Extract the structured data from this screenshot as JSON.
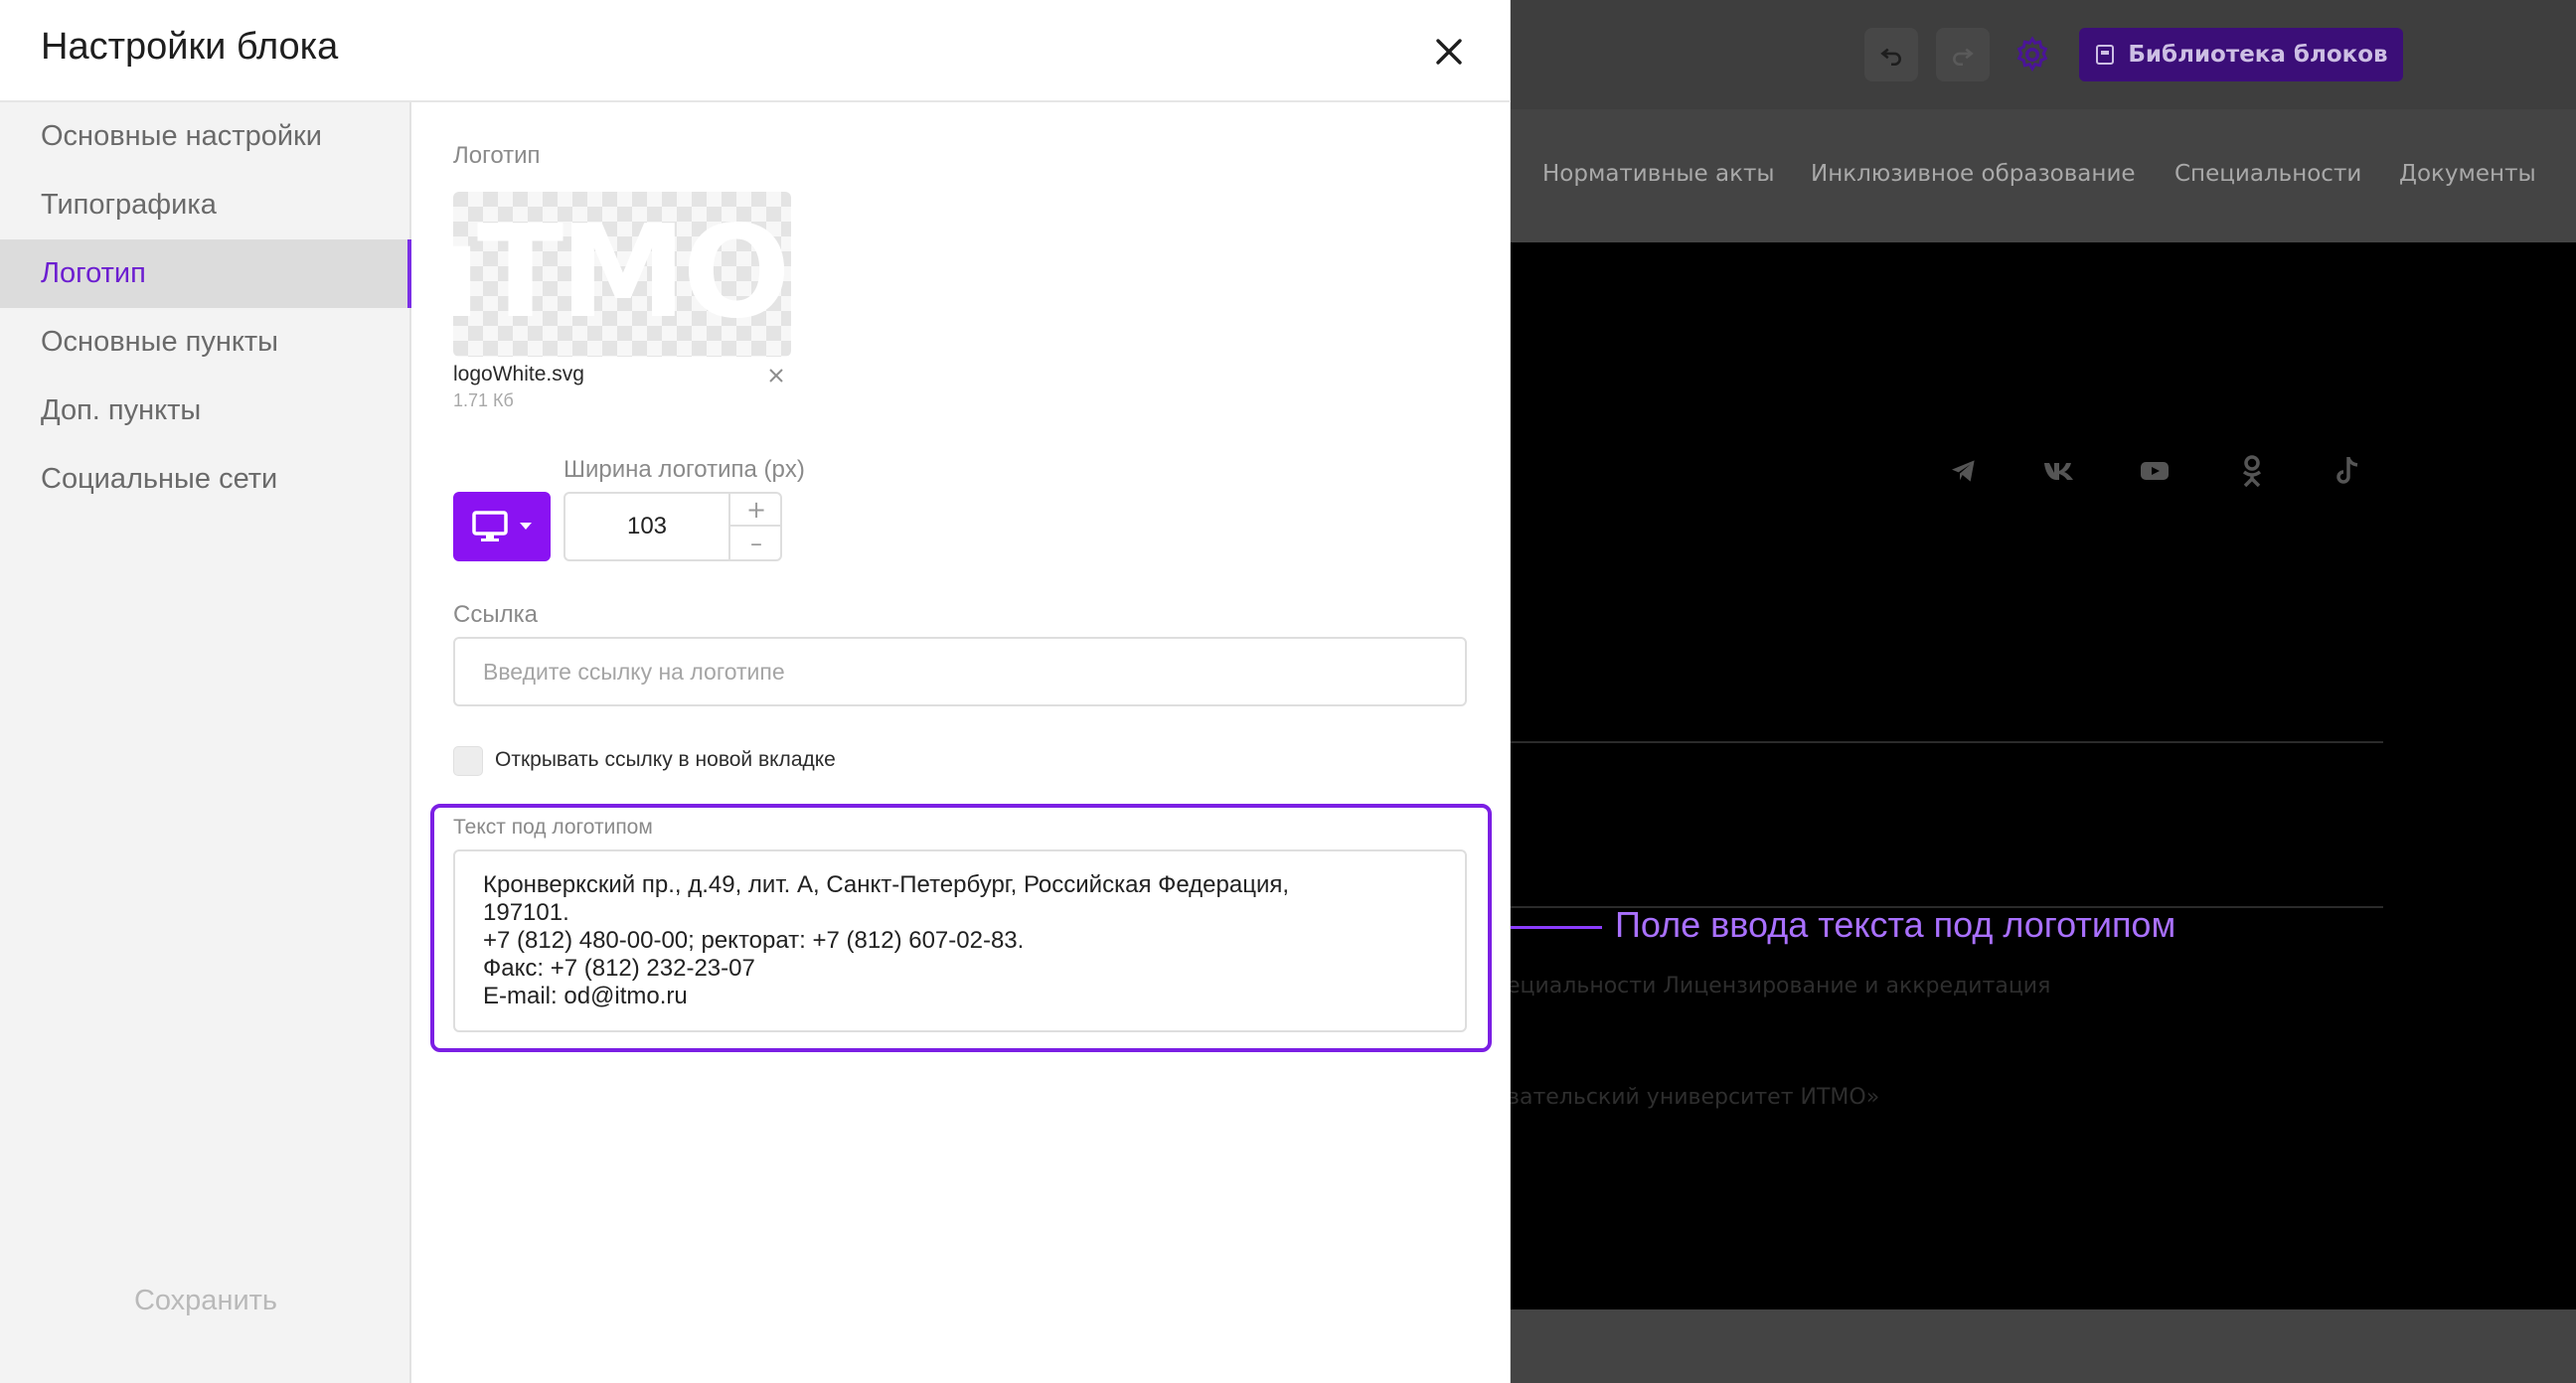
{
  "modal": {
    "title": "Настройки блока",
    "sidebar": {
      "items": [
        {
          "label": "Основные настройки"
        },
        {
          "label": "Типографика"
        },
        {
          "label": "Логотип"
        },
        {
          "label": "Основные пункты"
        },
        {
          "label": "Доп. пункты"
        },
        {
          "label": "Социальные сети"
        }
      ],
      "active": "Логотип",
      "save_label": "Сохранить"
    },
    "logo": {
      "section_label": "Логотип",
      "preview_text": "ıTMO",
      "file_name": "logoWhite.svg",
      "file_size": "1.71 Кб",
      "width_label": "Ширина логотипа (px)",
      "width_value": "103",
      "step_up": "+",
      "step_down": "–"
    },
    "link": {
      "label": "Ссылка",
      "placeholder": "Введите ссылку на логотипе",
      "value": ""
    },
    "new_tab": {
      "label": "Открывать ссылку в новой вкладке",
      "checked": false
    },
    "text_below": {
      "label": "Текст под логотипом",
      "lines": [
        "Кронверкский пр., д.49, лит. А, Санкт-Петербург, Российская Федерация,",
        "197101.",
        "+7 (812) 480-00-00; ректорат: +7 (812) 607-02-83.",
        "Факс: +7 (812) 232-23-07",
        "E-mail: od@itmo.ru"
      ]
    }
  },
  "editor": {
    "library_button": "Библиотека блоков",
    "nav_links": [
      "Нормативные акты",
      "Инклюзивное образование",
      "Специальности",
      "Документы"
    ],
    "social_icons": [
      "telegram-icon",
      "vk-icon",
      "youtube-icon",
      "odnoklassniki-icon",
      "tiktok-icon"
    ],
    "ghost_text_1": "ециальности      Лицензирование и аккредитация",
    "ghost_text_2": "вательский университет ИТМО»"
  },
  "callout": {
    "text": "Поле ввода текста под логотипом",
    "color": "#a970ff"
  },
  "colors": {
    "accent": "#7b1fe4",
    "device_button": "#8a12f2",
    "library_button": "#3b0e78"
  }
}
